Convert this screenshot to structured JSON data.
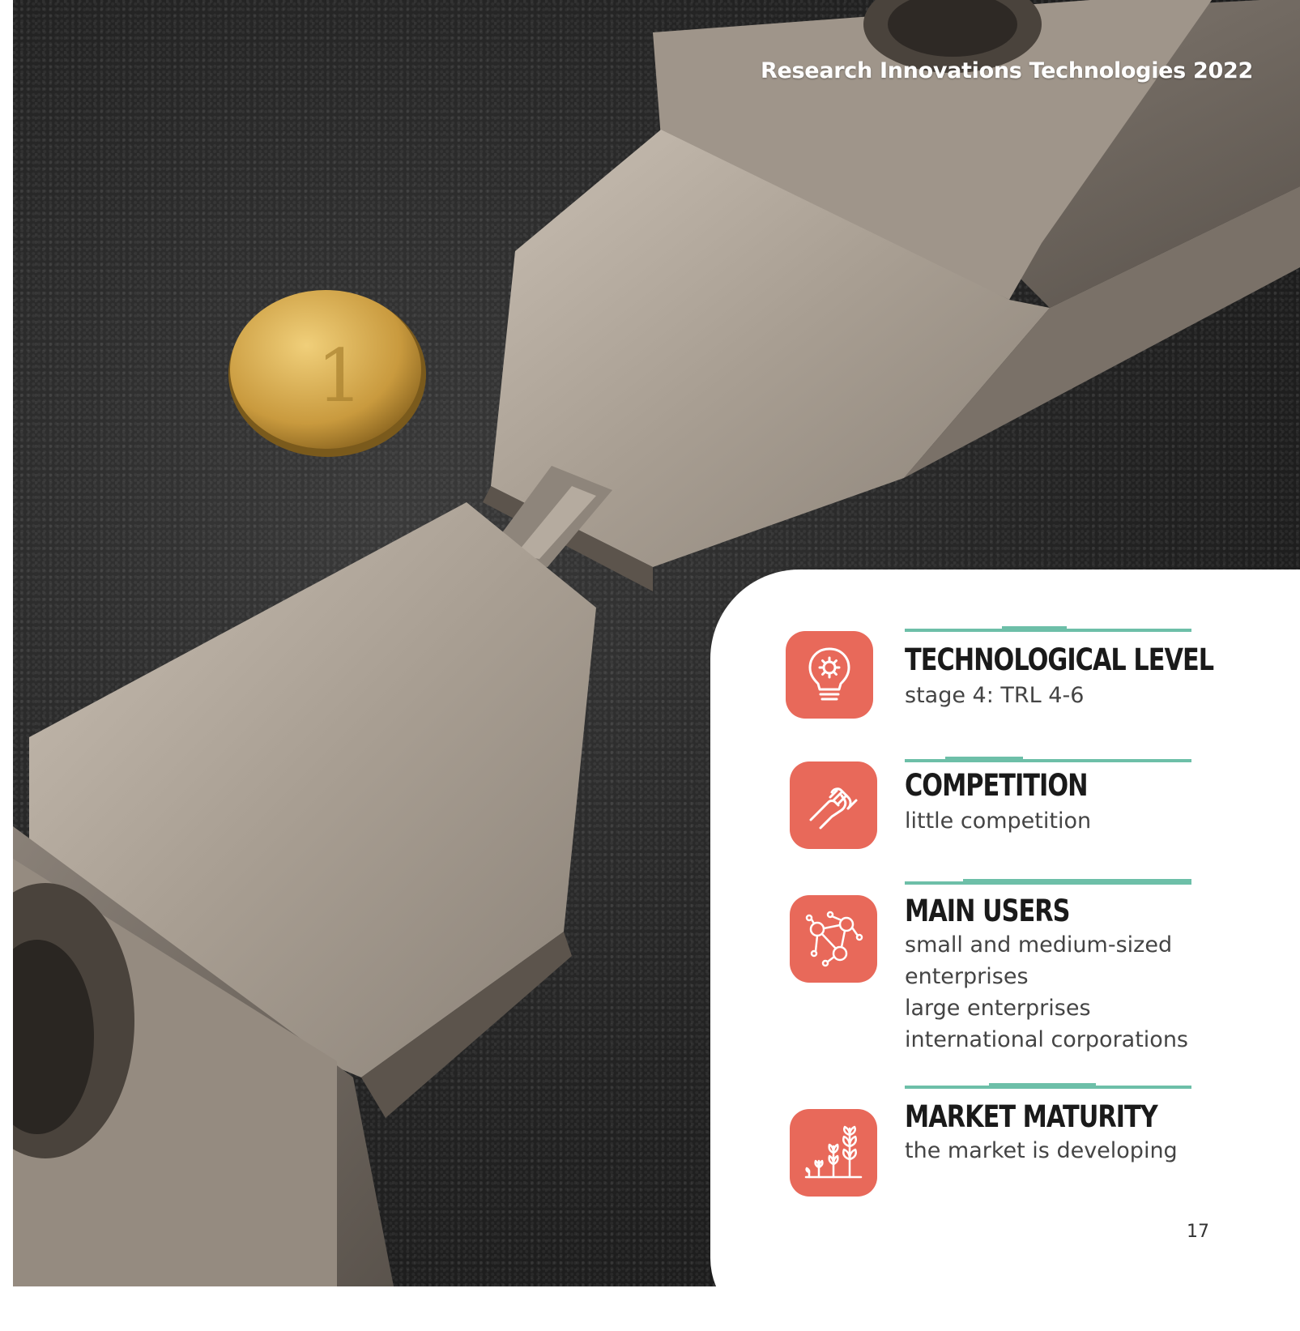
{
  "header": {
    "title": "Research Innovations Technologies 2022"
  },
  "photo": {
    "description_icon": "steel-specimen-grips-photo"
  },
  "items": [
    {
      "title": "TECHNOLOGICAL LEVEL",
      "values": [
        "stage 4: TRL 4-6"
      ],
      "icon": "lightbulb-gear-icon"
    },
    {
      "title": "COMPETITION",
      "values": [
        "little competition"
      ],
      "icon": "arm-wrestling-icon"
    },
    {
      "title": "MAIN USERS",
      "values": [
        "small and medium-sized",
        "enterprises",
        "large enterprises",
        "international corporations"
      ],
      "icon": "user-network-icon"
    },
    {
      "title": "MARKET MATURITY",
      "values": [
        "the market is developing"
      ],
      "icon": "growing-plants-icon"
    }
  ],
  "footer": {
    "page_number": "17"
  },
  "colors": {
    "accent": "#e8695a",
    "rule": "#6dbfa8"
  }
}
